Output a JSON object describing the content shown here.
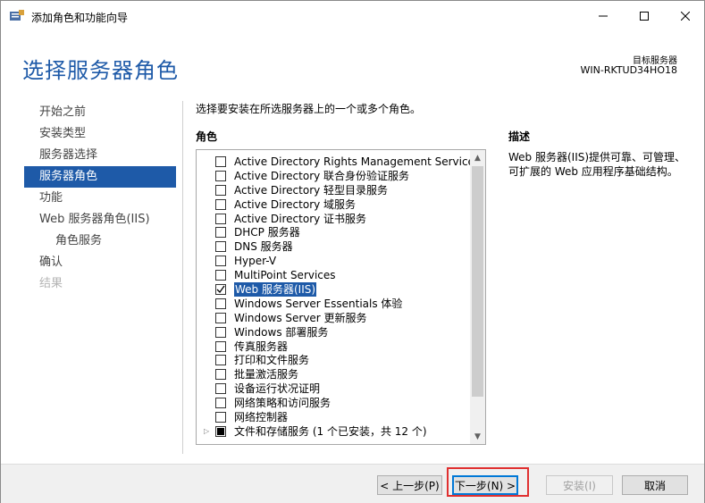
{
  "window": {
    "title": "添加角色和功能向导"
  },
  "header": {
    "title": "选择服务器角色",
    "target_label": "目标服务器",
    "target_value": "WIN-RKTUD34HO18"
  },
  "nav": {
    "items": [
      {
        "label": "开始之前",
        "state": "normal"
      },
      {
        "label": "安装类型",
        "state": "normal"
      },
      {
        "label": "服务器选择",
        "state": "normal"
      },
      {
        "label": "服务器角色",
        "state": "active"
      },
      {
        "label": "功能",
        "state": "normal"
      },
      {
        "label": "Web 服务器角色(IIS)",
        "state": "normal"
      },
      {
        "label": "角色服务",
        "state": "sub"
      },
      {
        "label": "确认",
        "state": "normal"
      },
      {
        "label": "结果",
        "state": "disabled"
      }
    ]
  },
  "main": {
    "instruction": "选择要安装在所选服务器上的一个或多个角色。",
    "roles_header": "角色",
    "description_header": "描述",
    "description": "Web 服务器(IIS)提供可靠、可管理、可扩展的 Web 应用程序基础结构。",
    "roles": [
      {
        "label": "Active Directory Rights Management Services",
        "checked": false
      },
      {
        "label": "Active Directory 联合身份验证服务",
        "checked": false
      },
      {
        "label": "Active Directory 轻型目录服务",
        "checked": false
      },
      {
        "label": "Active Directory 域服务",
        "checked": false
      },
      {
        "label": "Active Directory 证书服务",
        "checked": false
      },
      {
        "label": "DHCP 服务器",
        "checked": false
      },
      {
        "label": "DNS 服务器",
        "checked": false
      },
      {
        "label": "Hyper-V",
        "checked": false
      },
      {
        "label": "MultiPoint Services",
        "checked": false
      },
      {
        "label": "Web 服务器(IIS)",
        "checked": true,
        "selected": true
      },
      {
        "label": "Windows Server Essentials 体验",
        "checked": false
      },
      {
        "label": "Windows Server 更新服务",
        "checked": false
      },
      {
        "label": "Windows 部署服务",
        "checked": false
      },
      {
        "label": "传真服务器",
        "checked": false
      },
      {
        "label": "打印和文件服务",
        "checked": false
      },
      {
        "label": "批量激活服务",
        "checked": false
      },
      {
        "label": "设备运行状况证明",
        "checked": false
      },
      {
        "label": "网络策略和访问服务",
        "checked": false
      },
      {
        "label": "网络控制器",
        "checked": false
      },
      {
        "label": "文件和存储服务 (1 个已安装，共 12 个)",
        "checked": "partial",
        "expandable": true
      }
    ]
  },
  "footer": {
    "prev_label": "< 上一步(P)",
    "next_label": "下一步(N) >",
    "install_label": "安装(I)",
    "cancel_label": "取消"
  },
  "colors": {
    "accent": "#1e5aa8",
    "highlight": "#e03030"
  }
}
